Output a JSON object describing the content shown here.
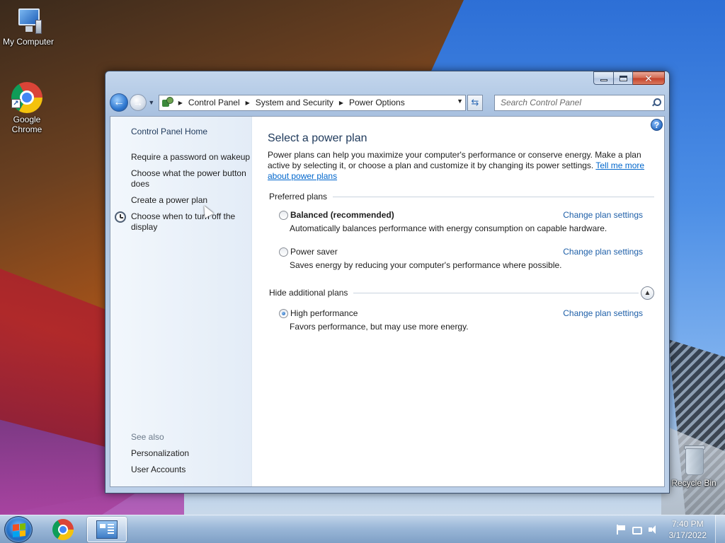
{
  "desktop": {
    "icons": [
      {
        "label": "My Computer",
        "icon": "computer-icon"
      },
      {
        "label": "Google Chrome",
        "icon": "chrome-icon"
      },
      {
        "label": "Recycle Bin",
        "icon": "recycle-bin-icon"
      }
    ]
  },
  "window": {
    "controls": {
      "minimize": "minimize",
      "maximize": "maximize",
      "close": "close"
    },
    "breadcrumb": [
      "Control Panel",
      "System and Security",
      "Power Options"
    ],
    "search": {
      "placeholder": "Search Control Panel"
    }
  },
  "sidebar": {
    "home": "Control Panel Home",
    "links": [
      "Require a password on wakeup",
      "Choose what the power button does",
      "Create a power plan",
      "Choose when to turn off the display"
    ],
    "see_also_title": "See also",
    "see_also": [
      "Personalization",
      "User Accounts"
    ]
  },
  "main": {
    "title": "Select a power plan",
    "intro": "Power plans can help you maximize your computer's performance or conserve energy. Make a plan active by selecting it, or choose a plan and customize it by changing its power settings.",
    "intro_link": "Tell me more about power plans",
    "preferred_label": "Preferred plans",
    "additional_label": "Hide additional plans",
    "plans": [
      {
        "name": "Balanced (recommended)",
        "description": "Automatically balances performance with energy consumption on capable hardware.",
        "link": "Change plan settings",
        "selected": false
      },
      {
        "name": "Power saver",
        "description": "Saves energy by reducing your computer's performance where possible.",
        "link": "Change plan settings",
        "selected": false
      },
      {
        "name": "High performance",
        "description": "Favors performance, but may use more energy.",
        "link": "Change plan settings",
        "selected": true
      }
    ]
  },
  "taskbar": {
    "clock": {
      "time": "7:40 PM",
      "date": "3/17/2022"
    }
  }
}
